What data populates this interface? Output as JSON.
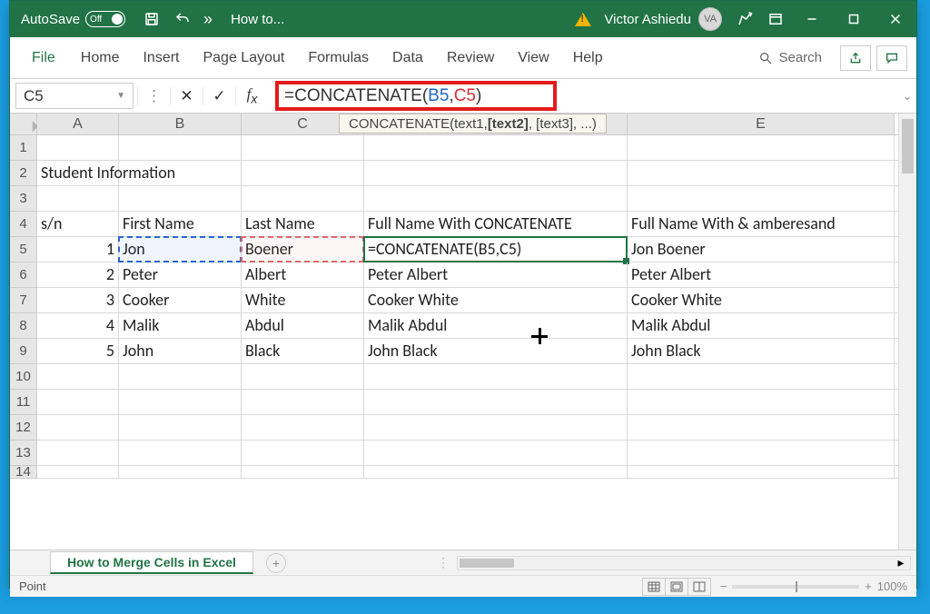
{
  "titlebar": {
    "autosave_label": "AutoSave",
    "autosave_state": "Off",
    "doc_title": "How to...",
    "user_name": "Victor Ashiedu",
    "user_initials": "VA"
  },
  "ribbon": {
    "tabs": [
      "File",
      "Home",
      "Insert",
      "Page Layout",
      "Formulas",
      "Data",
      "Review",
      "View",
      "Help"
    ],
    "search_label": "Search"
  },
  "formula_bar": {
    "namebox": "C5",
    "formula_prefix": "=CONCATENATE(",
    "formula_ref1": "B5",
    "formula_sep": ",",
    "formula_ref2": "C5",
    "formula_suffix": ")",
    "tooltip_fn": "CONCATENATE(",
    "tooltip_arg1": "text1, ",
    "tooltip_arg2": "[text2]",
    "tooltip_rest": ", [text3], ...)"
  },
  "columns": [
    "A",
    "B",
    "C",
    "",
    "E"
  ],
  "rows": [
    "1",
    "2",
    "3",
    "4",
    "5",
    "6",
    "7",
    "8",
    "9",
    "10",
    "11",
    "12",
    "13",
    "14"
  ],
  "sheet": {
    "r2": {
      "A": "Student Information"
    },
    "r4": {
      "A": "s/n",
      "B": "First Name",
      "C": "Last Name",
      "D": "Full Name With CONCATENATE",
      "E": "Full Name With & amberesand"
    },
    "r5": {
      "A": "1",
      "B": "Jon",
      "C": "Boener",
      "D": "=CONCATENATE(B5,C5)",
      "E": "Jon Boener"
    },
    "r6": {
      "A": "2",
      "B": "Peter",
      "C": "Albert",
      "D": "Peter Albert",
      "E": "Peter Albert"
    },
    "r7": {
      "A": "3",
      "B": "Cooker",
      "C": "White",
      "D": "Cooker White",
      "E": "Cooker White"
    },
    "r8": {
      "A": "4",
      "B": "Malik",
      "C": "Abdul",
      "D": "Malik Abdul",
      "E": "Malik Abdul"
    },
    "r9": {
      "A": "5",
      "B": "John",
      "C": "Black",
      "D": "John Black",
      "E": "John Black"
    }
  },
  "tabs": {
    "active": "How to Merge Cells in Excel"
  },
  "status": {
    "mode": "Point",
    "zoom": "100%"
  }
}
